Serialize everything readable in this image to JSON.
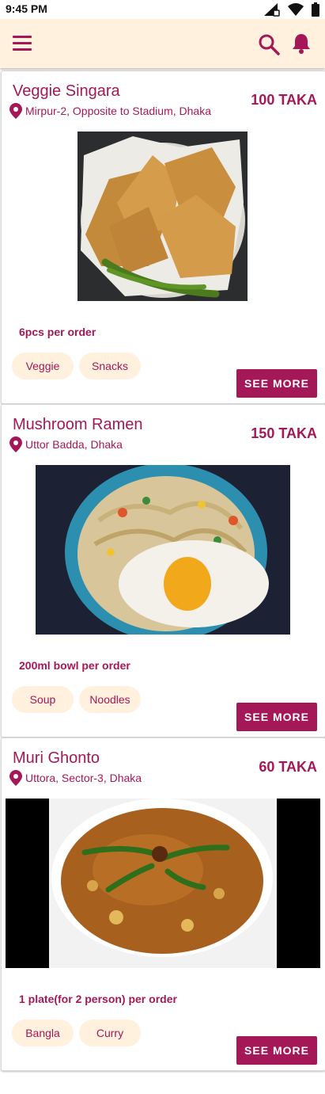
{
  "status_bar": {
    "time": "9:45 PM"
  },
  "app_bar": {
    "menu_icon": "menu-icon",
    "search_icon": "search-icon",
    "notification_icon": "bell-icon"
  },
  "colors": {
    "accent": "#a51857",
    "chip_bg": "#fff1de",
    "app_bar_bg": "#fff1de"
  },
  "cards": [
    {
      "title": "Veggie Singara",
      "price": "100 TAKA",
      "location": "Mirpur-2, Opposite to Stadium, Dhaka",
      "quantity": "6pcs per order",
      "tags": [
        "Veggie",
        "Snacks"
      ],
      "action": "SEE MORE"
    },
    {
      "title": "Mushroom Ramen",
      "price": "150 TAKA",
      "location": "Uttor Badda, Dhaka",
      "quantity": "200ml bowl per order",
      "tags": [
        "Soup",
        "Noodles"
      ],
      "action": "SEE MORE"
    },
    {
      "title": "Muri Ghonto",
      "price": "60 TAKA",
      "location": "Uttora, Sector-3, Dhaka",
      "quantity": "1 plate(for 2 person) per order",
      "tags": [
        "Bangla",
        "Curry"
      ],
      "action": "SEE MORE"
    }
  ]
}
